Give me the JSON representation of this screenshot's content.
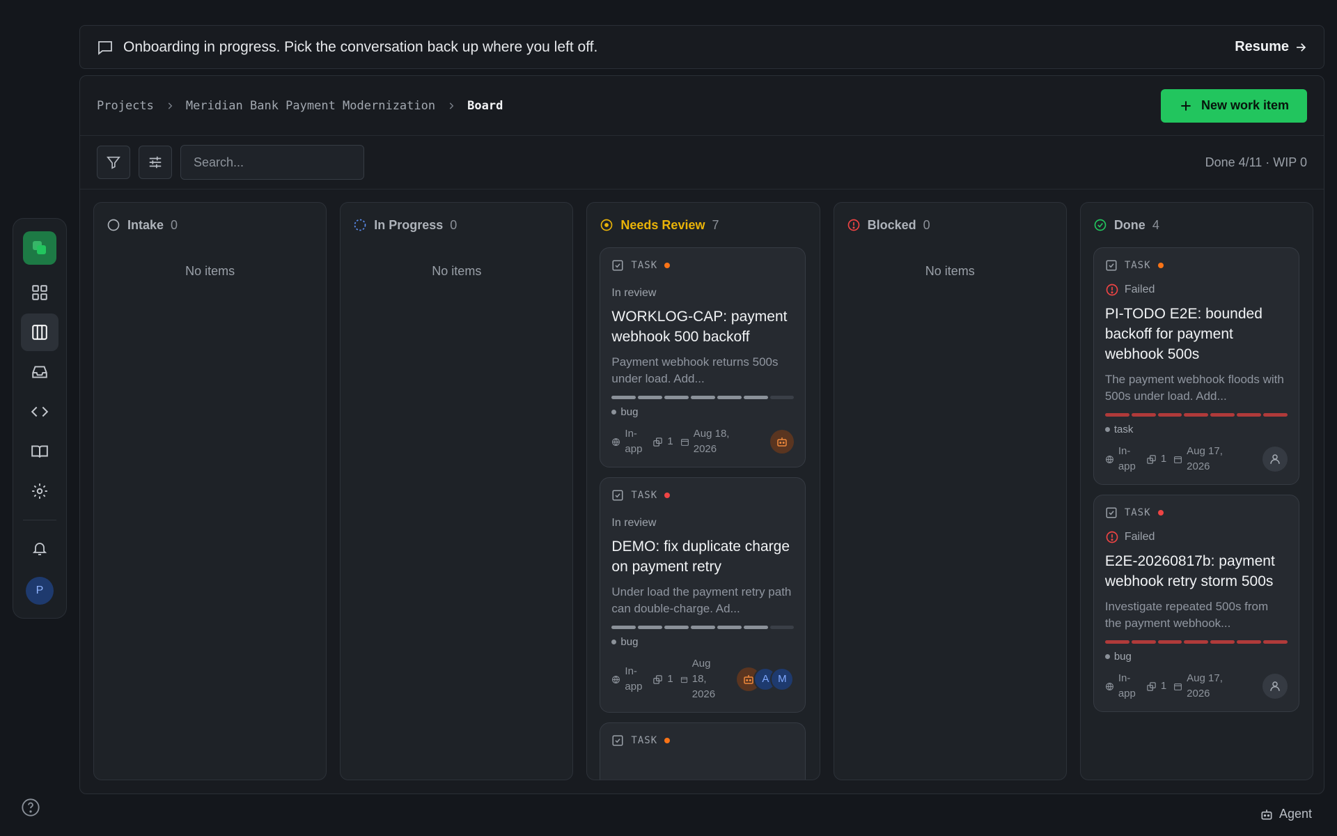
{
  "banner": {
    "text": "Onboarding in progress. Pick the conversation back up where you left off.",
    "resume_label": "Resume"
  },
  "breadcrumb": [
    "Projects",
    "Meridian Bank Payment Modernization",
    "Board"
  ],
  "header": {
    "new_item_label": "New work item"
  },
  "search": {
    "placeholder": "Search..."
  },
  "toolbar": {
    "stats": "Done 4/11 · WIP 0"
  },
  "empty_label": "No items",
  "columns": [
    {
      "name": "Intake",
      "count": "0",
      "color": "#aeb3ba"
    },
    {
      "name": "In Progress",
      "count": "0",
      "color": "#aeb3ba"
    },
    {
      "name": "Needs Review",
      "count": "7",
      "color": "#eab308"
    },
    {
      "name": "Blocked",
      "count": "0",
      "color": "#aeb3ba"
    },
    {
      "name": "Done",
      "count": "4",
      "color": "#aeb3ba"
    }
  ],
  "review_cards": [
    {
      "type": "TASK",
      "priority_color": "#f97316",
      "status": "In review",
      "title": "WORKLOG-CAP: payment webhook 500 backoff",
      "desc": "Payment webhook returns 500s under load. Add...",
      "tag": "bug",
      "channel": "In-app",
      "links": "1",
      "date": "Aug 18, 2026"
    },
    {
      "type": "TASK",
      "priority_color": "#ef4444",
      "status": "In review",
      "title": "DEMO: fix duplicate charge on payment retry",
      "desc": "Under load the payment retry path can double-charge. Ad...",
      "tag": "bug",
      "channel": "In-app",
      "links": "1",
      "date": "Aug 18, 2026",
      "assignees": [
        "A",
        "M"
      ]
    },
    {
      "type": "TASK",
      "priority_color": "#f97316"
    }
  ],
  "done_cards": [
    {
      "type": "TASK",
      "priority_color": "#f97316",
      "status": "Failed",
      "title": "PI-TODO E2E: bounded backoff for payment webhook 500s",
      "desc": "The payment webhook floods with 500s under load. Add...",
      "tag": "task",
      "channel": "In-app",
      "links": "1",
      "date": "Aug 17, 2026"
    },
    {
      "type": "TASK",
      "priority_color": "#ef4444",
      "status": "Failed",
      "title": "E2E-20260817b: payment webhook retry storm 500s",
      "desc": "Investigate repeated 500s from the payment webhook...",
      "tag": "bug",
      "channel": "In-app",
      "links": "1",
      "date": "Aug 17, 2026"
    }
  ],
  "rail": {
    "avatar_letter": "P"
  },
  "agent_label": "Agent"
}
